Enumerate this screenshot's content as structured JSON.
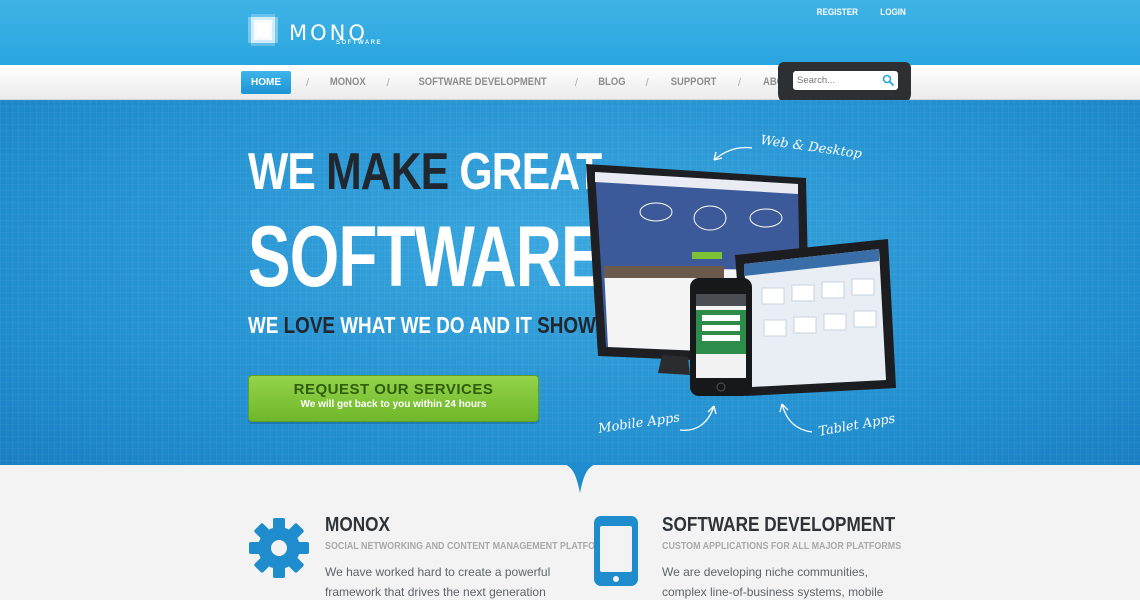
{
  "brand": {
    "name": "MONO",
    "tagline": "SOFTWARE"
  },
  "top_links": [
    "REGISTER",
    "LOGIN"
  ],
  "nav": {
    "items": [
      "HOME",
      "MONOX",
      "SOFTWARE DEVELOPMENT",
      "BLOG",
      "SUPPORT",
      "ABOUT US"
    ],
    "separator": "/",
    "active": "HOME"
  },
  "search": {
    "placeholder": "Search..."
  },
  "hero": {
    "line1_a": "WE ",
    "line1_b": "MAKE",
    "line1_c": " GREAT",
    "line2": "SOFTWARE",
    "line3_a": "WE ",
    "line3_b": "LOVE",
    "line3_c": " WHAT WE DO AND IT ",
    "line3_d": "SHOWS",
    "cta_title": "REQUEST OUR SERVICES",
    "cta_sub": "We will get back to you within 24 hours",
    "annotations": {
      "desktop": "Web & Desktop",
      "mobile": "Mobile Apps",
      "tablet": "Tablet Apps"
    }
  },
  "features": [
    {
      "title": "MONOX",
      "subtitle": "SOCIAL NETWORKING AND CONTENT MANAGEMENT PLATFORM",
      "text": "We have worked hard to create a powerful framework that drives the next generation of social web apps.",
      "icon": "gear-icon"
    },
    {
      "title": "SOFTWARE DEVELOPMENT",
      "subtitle": "CUSTOM APPLICATIONS FOR ALL MAJOR PLATFORMS",
      "text": "We are developing niche communities, complex line-of-business systems, mobile apps... If you can",
      "icon": "tablet-icon"
    }
  ],
  "colors": {
    "accent": "#2aa5df",
    "cta": "#7cc234",
    "dark": "#21272e"
  }
}
